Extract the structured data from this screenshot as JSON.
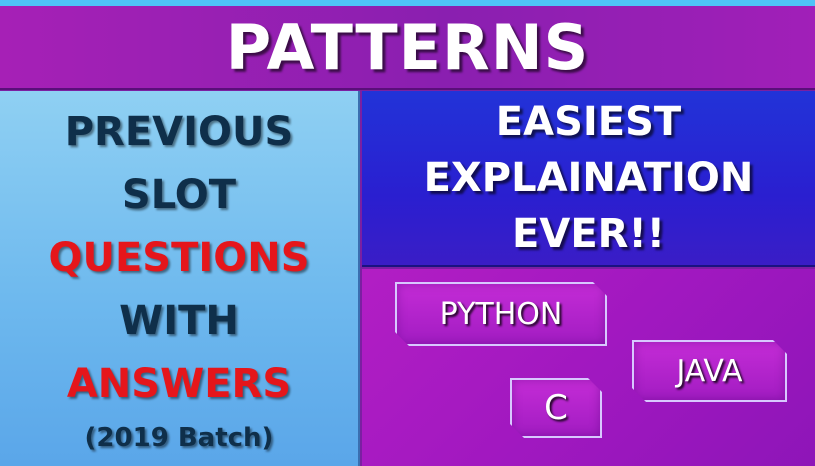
{
  "banner": {
    "title": "PATTERNS"
  },
  "left_panel": {
    "lines": [
      {
        "text": "PREVIOUS",
        "color": "#0f2f4a"
      },
      {
        "text": "SLOT",
        "color": "#0f2f4a"
      },
      {
        "text": "QUESTIONS",
        "color": "#e5161b"
      },
      {
        "text": "WITH",
        "color": "#0f2f4a"
      },
      {
        "text": "ANSWERS",
        "color": "#e5161b"
      }
    ],
    "batch": {
      "text": "(2019 Batch)",
      "color": "#0f2f4a"
    }
  },
  "right_top": {
    "lines": [
      "EASIEST",
      "EXPLAINATION",
      "EVER!!"
    ]
  },
  "languages": {
    "python": "PYTHON",
    "java": "JAVA",
    "c": "C"
  },
  "colors": {
    "banner": "#8a1fb0",
    "left_panel": "#6eb9ee",
    "right_top": "#2a1fd0",
    "right_bottom": "#a118c0",
    "accent_red": "#e5161b",
    "dark_text": "#0f2f4a"
  }
}
